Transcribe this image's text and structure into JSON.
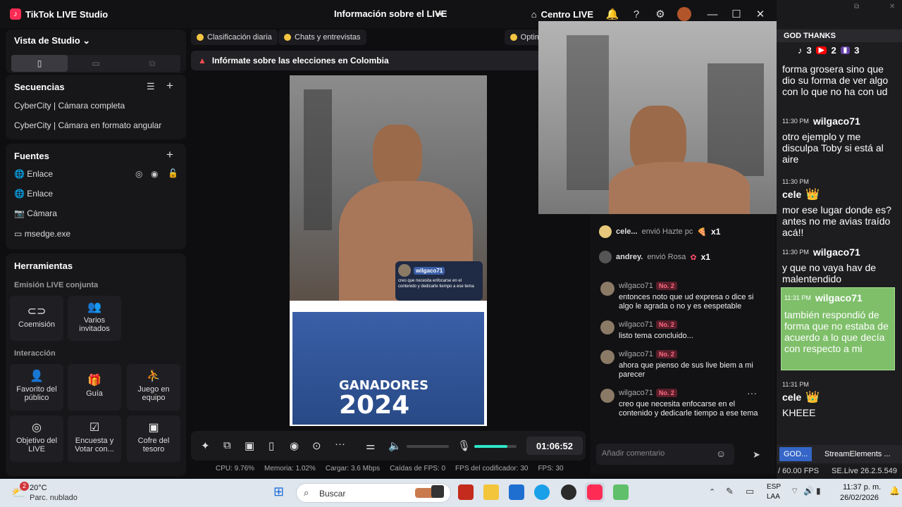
{
  "app": {
    "name": "TikTok LIVE Studio",
    "window_title": "Información sobre el LIVE",
    "home_label": "Centro LIVE"
  },
  "left": {
    "studio_view": "Vista de Studio",
    "sequences": {
      "title": "Secuencias",
      "items": [
        "CyberCity | Cámara completa",
        "CyberCity | Cámara en formato angular"
      ]
    },
    "sources": {
      "title": "Fuentes",
      "items": [
        "Enlace",
        "Enlace",
        "Cámara",
        "msedge.exe"
      ]
    },
    "tools": {
      "title": "Herramientas",
      "joint_title": "Emisión LIVE conjunta",
      "joint": [
        "Coemisión",
        "Varios invitados"
      ],
      "interaction_title": "Interacción",
      "interaction": [
        "Favorito del público",
        "Guía",
        "Juego en equipo",
        "Objetivo del LIVE",
        "Encuesta y Votar con...",
        "Cofre del tesoro"
      ]
    }
  },
  "center": {
    "chips": [
      "Clasificación diaria",
      "Chats y entrevistas",
      "Optim"
    ],
    "notice": "Infórmate sobre las elecciones en Colombia",
    "preview": {
      "comment_user": "wilgaco71",
      "comment_text": "creo que necesita enfocarse en el contenido y dedicarle tiempo a ese tema",
      "poster_title": "GANADORES",
      "poster_year": "2024"
    },
    "timer": "01:06:52",
    "stats": [
      "CPU: 9.76%",
      "Memoria: 1.02%",
      "Cargar: 3.6 Mbps",
      "Caídas de FPS: 0",
      "FPS del codificador: 30",
      "FPS: 30"
    ]
  },
  "chat": {
    "gifts": [
      {
        "user": "cele...",
        "text": "envió Hazte pc",
        "count": "x1"
      },
      {
        "user": "andrey.",
        "text": "envió Rosa",
        "count": "x1"
      }
    ],
    "messages": [
      {
        "user": "wilgaco71",
        "badge": "No. 2",
        "text": "entonces noto que ud expresa o dice si algo le agrada o no y es eespetable"
      },
      {
        "user": "wilgaco71",
        "badge": "No. 2",
        "text": "listo tema concluido..."
      },
      {
        "user": "wilgaco71",
        "badge": "No. 2",
        "text": "ahora que pienso de sus live biem a mi parecer"
      },
      {
        "user": "wilgaco71",
        "badge": "No. 2",
        "text": "creo que necesita enfocarse en el contenido y dedicarle tiempo a ese tema"
      }
    ],
    "input_placeholder": "Añadir comentario"
  },
  "overlay": {
    "header": "GOD THANKS",
    "counts": [
      "3",
      "2",
      "3"
    ],
    "msg1": "forma grosera sino que dio su forma de ver algo con lo que no ha con ud",
    "t1": "11:30 PM",
    "u1": "wilgaco71",
    "m1": "otro ejemplo y me disculpa Toby si está al aire",
    "t2": "11:30 PM",
    "u2": "cele",
    "m2": "mor ese lugar donde es? antes no me avias traído acá!!",
    "t3": "11:30 PM",
    "u3": "wilgaco71",
    "m3": "y que no vaya hav de malentendido",
    "t4": "11:31 PM",
    "u4": "wilgaco71",
    "m4": "también respondió de forma que no estaba de acuerdo a lo que decía con respecto a mi",
    "t5": "11:31 PM",
    "u5": "cele",
    "m5": "KHEEE",
    "tabs": [
      "GOD...",
      "StreamElements ..."
    ],
    "fps": "/ 60.00 FPS",
    "version": "SE.Live 26.2.5.549"
  },
  "taskbar": {
    "weather_temp": "20°C",
    "weather_desc": "Parc. nublado",
    "weather_badge": "2",
    "search": "Buscar",
    "lang": "ESP",
    "lang2": "LAA",
    "time": "11:37 p. m.",
    "date": "26/02/2026"
  }
}
